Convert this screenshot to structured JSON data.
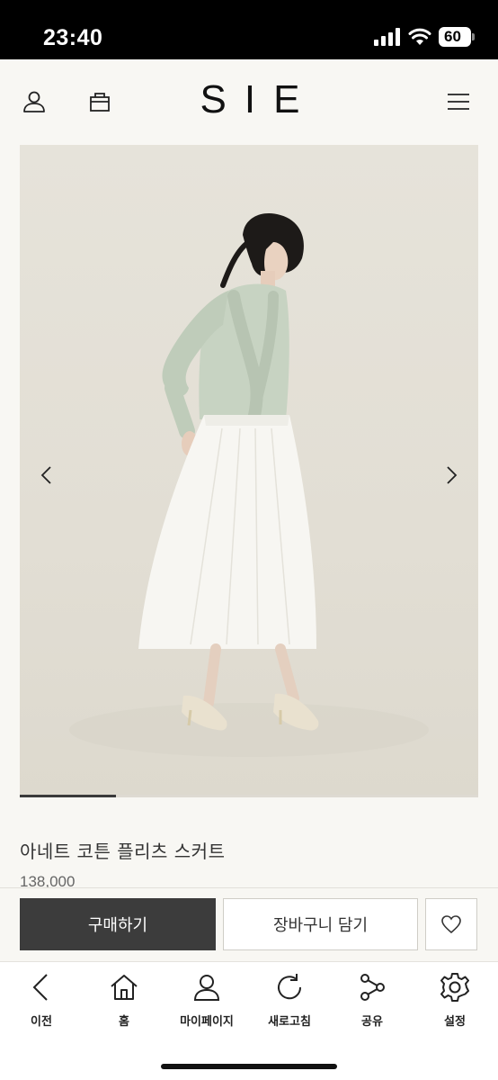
{
  "status_bar": {
    "time": "23:40",
    "battery": "60"
  },
  "header": {
    "logo": "SIE",
    "user_icon": "user-icon",
    "cart_icon": "shopping-bag-icon",
    "menu_icon": "hamburger-menu-icon"
  },
  "product": {
    "name": "아네트 코튼 플리츠 스커트",
    "price": "138,000",
    "gallery_progress": 0.21
  },
  "actions": {
    "buy_label": "구매하기",
    "cart_label": "장바구니 담기",
    "wish_icon": "heart-icon"
  },
  "bottom_nav": {
    "items": [
      {
        "label": "이전",
        "icon": "back-arrow-icon"
      },
      {
        "label": "홈",
        "icon": "home-icon"
      },
      {
        "label": "마이페이지",
        "icon": "user-icon"
      },
      {
        "label": "새로고침",
        "icon": "refresh-icon"
      },
      {
        "label": "공유",
        "icon": "share-icon"
      },
      {
        "label": "설정",
        "icon": "gear-icon"
      }
    ]
  },
  "colors": {
    "accent_dark": "#3c3c3c",
    "background": "#f8f7f3"
  }
}
